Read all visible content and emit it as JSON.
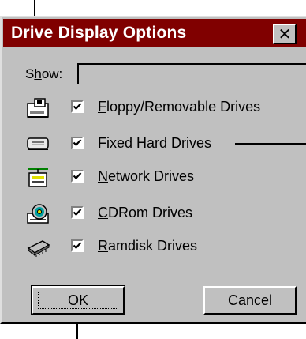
{
  "dialog": {
    "title": "Drive Display Options",
    "close_glyph": "✕"
  },
  "show": {
    "label_prefix": "S",
    "label_underlined": "h",
    "label_suffix": "ow:"
  },
  "options": [
    {
      "pre": "",
      "ul": "F",
      "post": "loppy/Removable Drives",
      "checked": true,
      "icon": "floppy-drive-icon"
    },
    {
      "pre": "Fixed ",
      "ul": "H",
      "post": "ard Drives",
      "checked": true,
      "icon": "hard-drive-icon"
    },
    {
      "pre": "",
      "ul": "N",
      "post": "etwork Drives",
      "checked": true,
      "icon": "network-drive-icon"
    },
    {
      "pre": "",
      "ul": "C",
      "post": "DRom Drives",
      "checked": true,
      "icon": "cdrom-drive-icon"
    },
    {
      "pre": "",
      "ul": "R",
      "post": "amdisk Drives",
      "checked": true,
      "icon": "ramdisk-drive-icon"
    }
  ],
  "buttons": {
    "ok": "OK",
    "cancel": "Cancel"
  },
  "colors": {
    "titlebar": "#800000",
    "face": "#c0c0c0"
  }
}
